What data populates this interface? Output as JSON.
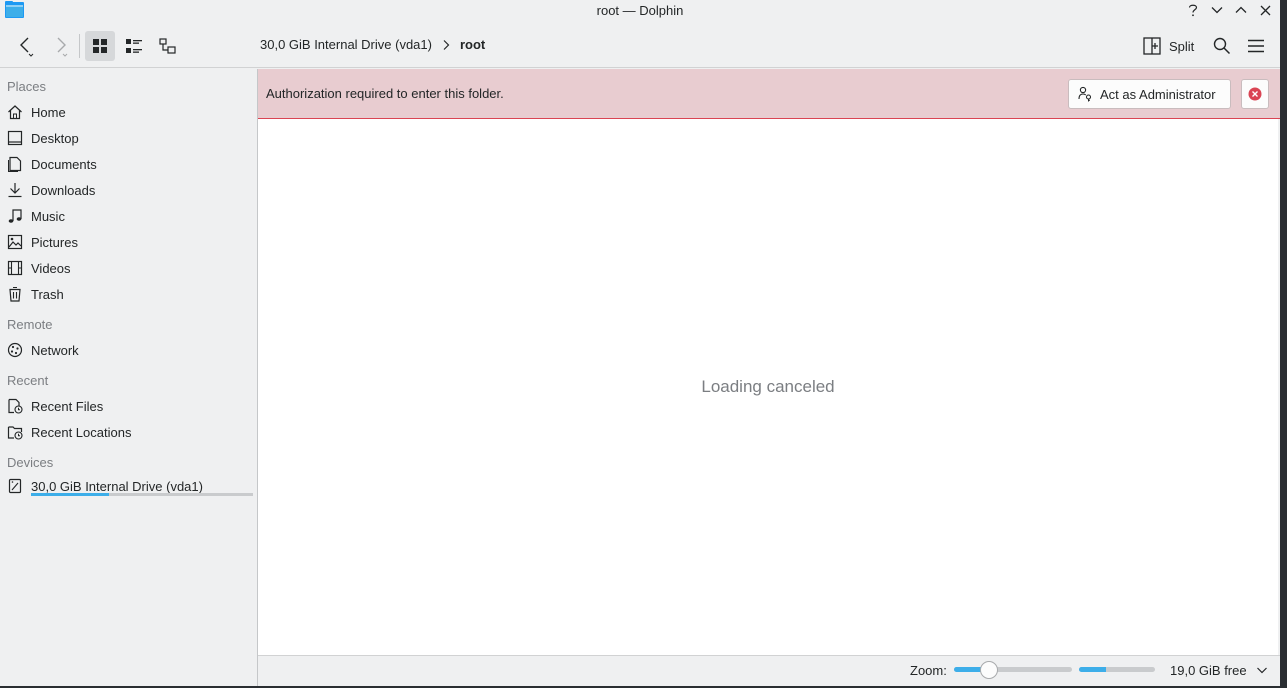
{
  "window": {
    "title": "root — Dolphin"
  },
  "toolbar": {
    "breadcrumb": [
      "30,0 GiB Internal Drive (vda1)",
      "root"
    ],
    "split_label": "Split"
  },
  "sidebar": {
    "sections": {
      "places": "Places",
      "remote": "Remote",
      "recent": "Recent",
      "devices": "Devices"
    },
    "places": [
      {
        "label": "Home",
        "icon": "home-icon"
      },
      {
        "label": "Desktop",
        "icon": "desktop-icon"
      },
      {
        "label": "Documents",
        "icon": "documents-icon"
      },
      {
        "label": "Downloads",
        "icon": "downloads-icon"
      },
      {
        "label": "Music",
        "icon": "music-icon"
      },
      {
        "label": "Pictures",
        "icon": "pictures-icon"
      },
      {
        "label": "Videos",
        "icon": "videos-icon"
      },
      {
        "label": "Trash",
        "icon": "trash-icon"
      }
    ],
    "remote": [
      {
        "label": "Network",
        "icon": "network-icon"
      }
    ],
    "recent": [
      {
        "label": "Recent Files",
        "icon": "recent-files-icon"
      },
      {
        "label": "Recent Locations",
        "icon": "recent-locations-icon"
      }
    ],
    "devices": [
      {
        "label": "30,0 GiB Internal Drive (vda1)",
        "icon": "drive-icon",
        "used_fraction": 0.35
      }
    ]
  },
  "banner": {
    "message": "Authorization required to enter this folder.",
    "admin_button": "Act as Administrator"
  },
  "content": {
    "empty_message": "Loading canceled"
  },
  "statusbar": {
    "zoom_label": "Zoom:",
    "zoom_fraction": 0.3,
    "space_used_fraction": 0.35,
    "free_label": "19,0 GiB free"
  },
  "colors": {
    "accent": "#3daee9",
    "banner_bg": "#e8ccd0",
    "error": "#da4453"
  }
}
